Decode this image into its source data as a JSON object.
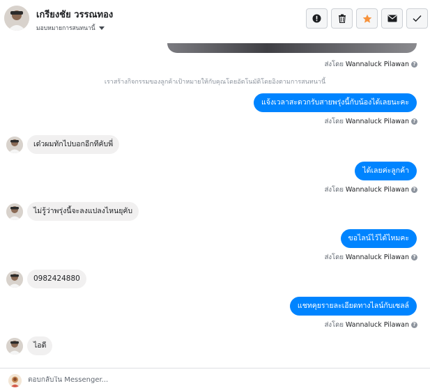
{
  "header": {
    "contact_name": "เกรียงชัย วรรณทอง",
    "assign_label": "มอบหมายการสนทนานี้",
    "actions": [
      {
        "icon": "alert-icon",
        "color": "#1c1e21"
      },
      {
        "icon": "trash-icon",
        "color": "#1c1e21"
      },
      {
        "icon": "star-icon",
        "color": "#f7923b"
      },
      {
        "icon": "mail-icon",
        "color": "#1c1e21"
      },
      {
        "icon": "check-icon",
        "color": "#1c1e21"
      }
    ]
  },
  "colors": {
    "accent": "#0084ff",
    "incoming_bubble": "#f1f0f0",
    "star": "#f7923b"
  },
  "sent_by_prefix": "ส่งโดย",
  "agent_name": "Wannaluck Pilawan",
  "system_note": "เราสร้างกิจกรรมของลูกค้าเป้าหมายให้กับคุณโดยอัตโนมัติโดยอิงตามการสนทนานี้",
  "messages": [
    {
      "direction": "out",
      "text": "แจ้งเวลาสะดวกรับสายพรุ่งนี้กับน้องได้เลยนะคะ"
    },
    {
      "direction": "in",
      "text": "เด๋วผมทักไปบอกอีกทีคับพี่"
    },
    {
      "direction": "out",
      "text": "ได้เลยค่ะลูกค้า"
    },
    {
      "direction": "in",
      "text": "ไม่รู้ว่าพรุ่งนี้จะลงแปลงไหนยุคับ"
    },
    {
      "direction": "out",
      "text": "ขอไลน์ไว้ได้ไหมคะ"
    },
    {
      "direction": "in",
      "text": "0982424880"
    },
    {
      "direction": "out",
      "text": "แชทคุยรายละเอียดทางไลน์กับเซลล์"
    },
    {
      "direction": "in",
      "text": "ไอดี"
    }
  ],
  "composer": {
    "placeholder": "ตอบกลับใน Messenger..."
  }
}
